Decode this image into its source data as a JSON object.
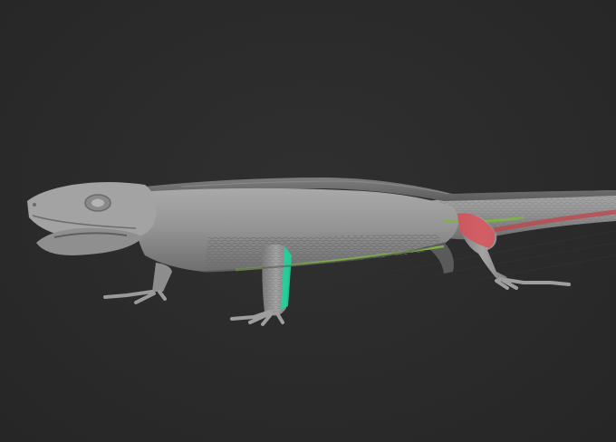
{
  "viewport": {
    "background": "#2b2b2b",
    "model": "lizard-sculpt",
    "mask_colors": {
      "front_leg": "#1fd39a",
      "hind_leg": "#d9525a",
      "belly_line": "#7fb04a",
      "tail_line": "#c0444c"
    }
  }
}
